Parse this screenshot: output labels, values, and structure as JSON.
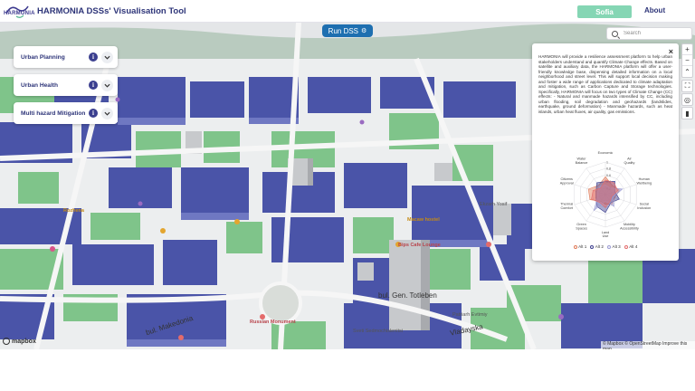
{
  "header": {
    "logo_text": "HARMONIA",
    "title": "HARMONIA DSSs' Visualisation Tool",
    "city_button": "Sofia",
    "about_link": "About"
  },
  "toolbar": {
    "run_label": "Run DSS",
    "search_placeholder": "Search"
  },
  "categories": [
    {
      "label": "Urban Planning"
    },
    {
      "label": "Urban Health"
    },
    {
      "label": "Multi hazard Mitigation"
    }
  ],
  "info_panel": {
    "close": "×",
    "text": "HARMONIA will provide a resilience assessment platform to help urban stakeholders understand and quantify Climate Change effects. Based on satellite and auxiliary data, the HARMONIA platform will offer a user-friendly knowledge base, dispensing detailed information on a local neighborhood and street level. This will support local decision making and foster a wide range of applications dedicated to climate adaptation and mitigation, such as Carbon Capture and Storage technologies. Specifically, HARMONIA will focus on two types of Climate Change (CC) effects: - Natural and manmade hazards intensified by CC, including urban flooding, soil degradation and geohazards (landslides, earthquake, ground deformation) - Manmade hazards, such as heat islands, urban heat fluxes, air quality, gas emissions."
  },
  "chart_data": {
    "type": "radar",
    "categories": [
      "Economic",
      "Air Quality",
      "Human Wellbeing",
      "Social Inclusion",
      "Mobility Accessibility",
      "Land Use",
      "Green Spaces",
      "Thermal Comfort",
      "Citizens Approval",
      "Water Balance"
    ],
    "tick_labels": [
      "1",
      "0.8",
      "0.6",
      "0.4",
      "0.2"
    ],
    "range": [
      0,
      1
    ],
    "series": [
      {
        "name": "Alt 1",
        "color": "#e07b59",
        "values": [
          0.55,
          0.35,
          0.45,
          0.3,
          0.35,
          0.3,
          0.25,
          0.5,
          0.55,
          0.35
        ]
      },
      {
        "name": "Alt 2",
        "color": "#3d3f8e",
        "values": [
          0.4,
          0.5,
          0.3,
          0.45,
          0.3,
          0.55,
          0.45,
          0.3,
          0.3,
          0.45
        ]
      },
      {
        "name": "Alt 3",
        "color": "#9a9ad3",
        "values": [
          0.3,
          0.25,
          0.55,
          0.25,
          0.45,
          0.2,
          0.6,
          0.25,
          0.25,
          0.3
        ]
      },
      {
        "name": "Alt 4",
        "color": "#e46b6b",
        "values": [
          0.45,
          0.45,
          0.4,
          0.2,
          0.25,
          0.4,
          0.3,
          0.45,
          0.4,
          0.25
        ]
      }
    ]
  },
  "map": {
    "labels_red": [
      "Russian Monument",
      "Bips Cafe Lounge"
    ],
    "labels_gold": [
      "Rozhenа",
      "Macaw hostel"
    ],
    "labels_small": [
      "Ekzarh Yosif",
      "Sveti Sedmochislenitsi",
      "Patriarh Evtimiy"
    ],
    "streets": [
      "bul. Makedonia",
      "bul. Gen. Totleben",
      "Vladayska"
    ]
  },
  "attribution": {
    "logo": "mapbox",
    "text": "© Mapbox © OpenStreetMap Improve this map"
  }
}
